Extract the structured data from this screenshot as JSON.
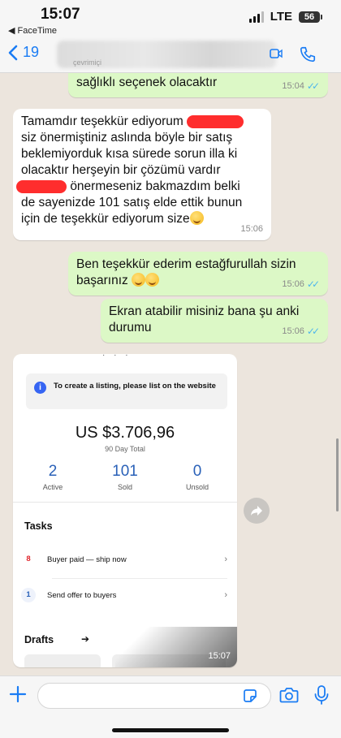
{
  "status_bar": {
    "time": "15:07",
    "back_app": "◀ FaceTime",
    "network": "LTE",
    "battery": "56"
  },
  "header": {
    "back_count": "19",
    "contact_status": "çevrimiçi"
  },
  "messages": [
    {
      "direction": "outgoing",
      "text": "sağlıklı seçenek olacaktır",
      "time": "15:04",
      "read": true
    },
    {
      "direction": "incoming",
      "lines": [
        "Tamamdır teşekkür ediyorum",
        "siz önermiştiniz aslında böyle bir satış",
        "beklemiyorduk kısa sürede sorun illa ki",
        "olacaktır herşeyin bir çözümü vardır",
        "önermeseniz bakmazdım belki",
        "de sayenizde 101 satış elde ettik bunun",
        "için de teşekkür ediyorum size"
      ],
      "time": "15:06"
    },
    {
      "direction": "outgoing",
      "lines": [
        "Ben teşekkür ederim estağfurullah sizin",
        "başarınız"
      ],
      "time": "15:06",
      "read": true
    },
    {
      "direction": "outgoing",
      "lines": [
        "Ekran atabilir misiniz bana şu anki",
        "durumu"
      ],
      "time": "15:06",
      "read": true
    }
  ],
  "shared_image": {
    "notice": "To create a listing, please list on the website",
    "amount": "US $3.706,96",
    "amount_label": "90 Day Total",
    "stats": [
      {
        "value": "2",
        "label": "Active"
      },
      {
        "value": "101",
        "label": "Sold"
      },
      {
        "value": "0",
        "label": "Unsold"
      }
    ],
    "tasks_title": "Tasks",
    "tasks": [
      {
        "count": "8",
        "label": "Buyer paid — ship now"
      },
      {
        "count": "1",
        "label": "Send offer to buyers"
      }
    ],
    "drafts_title": "Drafts",
    "time": "15:07"
  },
  "colors": {
    "outgoing_bubble": "#dcf8c6",
    "incoming_bubble": "#ffffff",
    "accent": "#1a7cf4",
    "read_ticks": "#4fb6ec",
    "redaction": "#ff2d2d"
  }
}
